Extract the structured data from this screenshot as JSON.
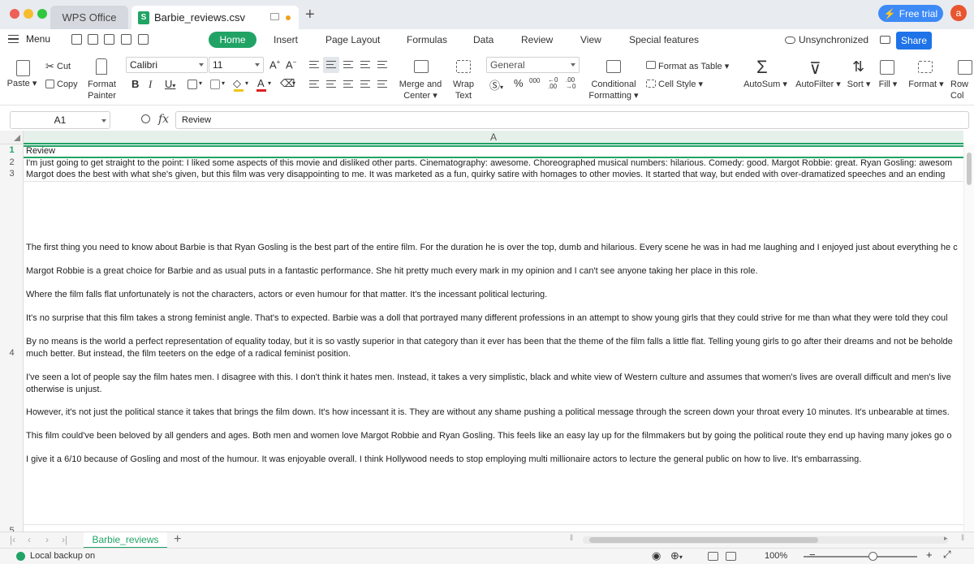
{
  "window": {
    "tabs": [
      {
        "label": "WPS Office"
      },
      {
        "label": "Barbie_reviews.csv",
        "icon": "spreadsheet-s-icon"
      }
    ],
    "free_trial": "Free trial",
    "avatar_letter": "a",
    "traffic_colors": [
      "#ee5f57",
      "#f7bd2f",
      "#2fc73f"
    ],
    "accent": "#21a366"
  },
  "menubar": {
    "menu": "Menu",
    "items": [
      "Home",
      "Insert",
      "Page Layout",
      "Formulas",
      "Data",
      "Review",
      "View",
      "Special features"
    ],
    "active": "Home",
    "sync_status": "Unsynchronized",
    "share": "Share"
  },
  "ribbon": {
    "paste": "Paste",
    "cut": "Cut",
    "copy": "Copy",
    "format_painter": [
      "Format",
      "Painter"
    ],
    "font_name": "Calibri",
    "font_size": "11",
    "merge_center": [
      "Merge and",
      "Center"
    ],
    "wrap_text": [
      "Wrap",
      "Text"
    ],
    "number_format": "General",
    "conditional_formatting": [
      "Conditional",
      "Formatting"
    ],
    "format_as_table": "Format as Table",
    "cell_style": "Cell Style",
    "autosum": "AutoSum",
    "autofilter": "AutoFilter",
    "sort": "Sort",
    "fill": "Fill",
    "format": "Format",
    "row_col": [
      "Row",
      "Col"
    ]
  },
  "formula_bar": {
    "cell_ref": "A1",
    "fx": "fx",
    "content": "Review"
  },
  "grid": {
    "column_header": "A",
    "row_numbers": [
      "1",
      "2",
      "3",
      "4",
      "5"
    ],
    "rows": {
      "r1": "Review",
      "r2": "I'm just going to get straight to the point: I liked some aspects of this movie and disliked other parts. Cinematography: awesome. Choreographed musical numbers: hilarious. Comedy: good. Margot Robbie: great. Ryan Gosling: awesom",
      "r3": "Margot does the best with what she's given, but this film was very disappointing to me. It was marketed as a fun, quirky satire with homages to other movies. It started that way, but ended with over-dramatized speeches and an ending",
      "r4_lines": [
        "The first thing you need to know about Barbie is that Ryan Gosling is the best part of the entire film. For the duration he is over the top, dumb and hilarious. Every scene he was in had me laughing and I enjoyed just about everything he c",
        "Margot Robbie is a great choice for Barbie and as usual puts in a fantastic performance. She hit pretty much every mark in my opinion and I can't see anyone taking her place in this role.",
        "Where the film falls flat unfortunately is not the characters, actors or even humour for that matter. It's the incessant political lecturing.",
        "It's no surprise that this film takes a strong feminist angle. That's to expected. Barbie was a doll that portrayed many different professions in an attempt to show young girls that they could strive for me than what they were told they coul",
        "By no means is the world a perfect representation of equality today, but it is so vastly superior in that category than it ever has been that the theme of the film falls a little flat. Telling young girls to go after their dreams and not be beholde",
        "much better. But instead, the film teeters on the edge of a radical feminist position.",
        "I've seen a lot of people say the film hates men. I disagree with this. I don't think it hates men. Instead, it takes a very simplistic, black and white view of Western culture and assumes that women's lives are overall difficult and men's live",
        "otherwise is unjust.",
        "However, it's not just the political stance it takes that brings the film down. It's how incessant it is. They are without any shame pushing a political message through the screen down your throat every 10 minutes. It's unbearable at times.",
        "This film could've been beloved by all genders and ages. Both men and women love Margot Robbie and Ryan Gosling. This feels like an easy lay up for the filmmakers but by going the political route they end up having many jokes go o",
        "I give it a 6/10 because of Gosling and most of the humour. It was enjoyable overall. I think Hollywood needs to stop employing multi millionaire actors to lecture the general public on how to live. It's embarrassing."
      ]
    }
  },
  "sheets": {
    "active": "Barbie_reviews",
    "add": "+"
  },
  "status": {
    "backup": "Local backup on",
    "zoom": "100%"
  }
}
